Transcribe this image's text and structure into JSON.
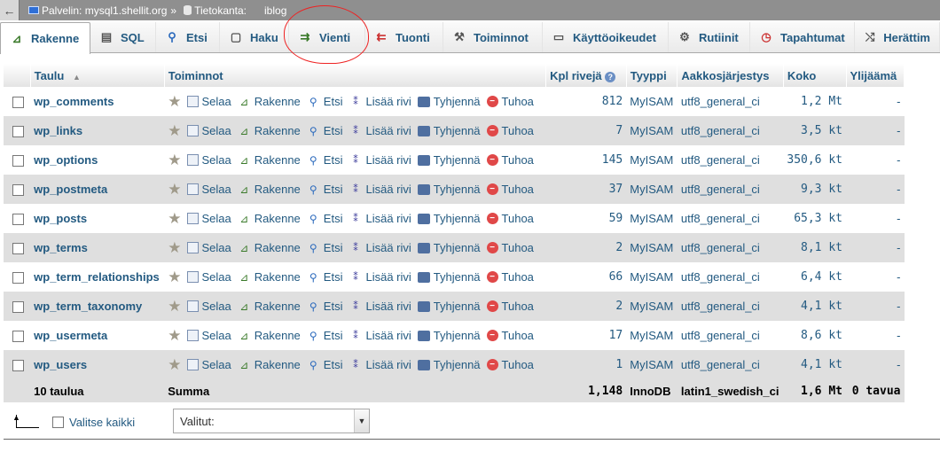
{
  "breadcrumb": {
    "server_label": "Palvelin: mysql1.shellit.org",
    "separator": "»",
    "database_label": "Tietokanta:",
    "database_name": "iblog"
  },
  "tabs": [
    {
      "label": "Rakenne",
      "icon": "structure-icon",
      "active": true
    },
    {
      "label": "SQL",
      "icon": "sql-icon"
    },
    {
      "label": "Etsi",
      "icon": "search-icon"
    },
    {
      "label": "Haku",
      "icon": "query-icon"
    },
    {
      "label": "Vienti",
      "icon": "export-icon"
    },
    {
      "label": "Tuonti",
      "icon": "import-icon"
    },
    {
      "label": "Toiminnot",
      "icon": "wrench-icon"
    },
    {
      "label": "Käyttöoikeudet",
      "icon": "privileges-icon"
    },
    {
      "label": "Rutiinit",
      "icon": "routines-icon"
    },
    {
      "label": "Tapahtumat",
      "icon": "events-icon"
    },
    {
      "label": "Herättim",
      "icon": "triggers-icon"
    }
  ],
  "table": {
    "headers": {
      "table": "Taulu",
      "actions": "Toiminnot",
      "rows": "Kpl rivejä",
      "type": "Tyyppi",
      "collation": "Aakkosjärjestys",
      "size": "Koko",
      "overhead": "Ylijäämä"
    },
    "action_labels": {
      "browse": "Selaa",
      "structure": "Rakenne",
      "search": "Etsi",
      "insert": "Lisää rivi",
      "empty": "Tyhjennä",
      "drop": "Tuhoa"
    },
    "rows": [
      {
        "name": "wp_comments",
        "rows": "812",
        "engine": "MyISAM",
        "collation": "utf8_general_ci",
        "size": "1,2 Mt",
        "overhead": "-"
      },
      {
        "name": "wp_links",
        "rows": "7",
        "engine": "MyISAM",
        "collation": "utf8_general_ci",
        "size": "3,5 kt",
        "overhead": "-"
      },
      {
        "name": "wp_options",
        "rows": "145",
        "engine": "MyISAM",
        "collation": "utf8_general_ci",
        "size": "350,6 kt",
        "overhead": "-"
      },
      {
        "name": "wp_postmeta",
        "rows": "37",
        "engine": "MyISAM",
        "collation": "utf8_general_ci",
        "size": "9,3 kt",
        "overhead": "-"
      },
      {
        "name": "wp_posts",
        "rows": "59",
        "engine": "MyISAM",
        "collation": "utf8_general_ci",
        "size": "65,3 kt",
        "overhead": "-"
      },
      {
        "name": "wp_terms",
        "rows": "2",
        "engine": "MyISAM",
        "collation": "utf8_general_ci",
        "size": "8,1 kt",
        "overhead": "-"
      },
      {
        "name": "wp_term_relationships",
        "rows": "66",
        "engine": "MyISAM",
        "collation": "utf8_general_ci",
        "size": "6,4 kt",
        "overhead": "-"
      },
      {
        "name": "wp_term_taxonomy",
        "rows": "2",
        "engine": "MyISAM",
        "collation": "utf8_general_ci",
        "size": "4,1 kt",
        "overhead": "-"
      },
      {
        "name": "wp_usermeta",
        "rows": "17",
        "engine": "MyISAM",
        "collation": "utf8_general_ci",
        "size": "8,6 kt",
        "overhead": "-"
      },
      {
        "name": "wp_users",
        "rows": "1",
        "engine": "MyISAM",
        "collation": "utf8_general_ci",
        "size": "4,1 kt",
        "overhead": "-"
      }
    ],
    "footer": {
      "count": "10 taulua",
      "sum_label": "Summa",
      "rows": "1,148",
      "engine": "InnoDB",
      "collation": "latin1_swedish_ci",
      "size": "1,6 Mt",
      "overhead": "0 tavua"
    }
  },
  "bottom": {
    "select_all_label": "Valitse kaikki",
    "with_selected": "Valitut:"
  },
  "colors": {
    "link": "#235a81",
    "annotation": "#e22222",
    "row_alt": "#dfdfdf"
  }
}
